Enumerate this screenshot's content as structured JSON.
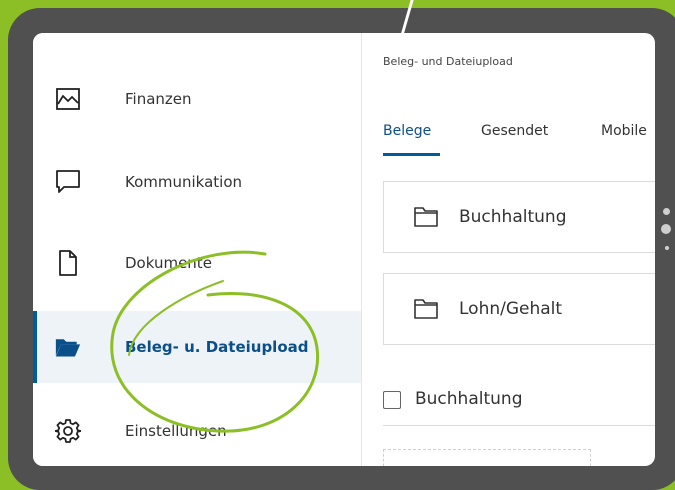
{
  "sidebar": {
    "items": [
      {
        "label": "Finanzen",
        "icon": "chart-line-icon"
      },
      {
        "label": "Kommunikation",
        "icon": "chat-bubble-icon"
      },
      {
        "label": "Dokumente",
        "icon": "document-icon"
      },
      {
        "label": "Beleg- u. Dateiupload",
        "icon": "folder-open-icon",
        "active": true
      },
      {
        "label": "Einstellungen",
        "icon": "gear-icon"
      }
    ]
  },
  "main": {
    "title": "Beleg- und Dateiupload",
    "tabs": [
      {
        "label": "Belege",
        "active": true
      },
      {
        "label": "Gesendet"
      },
      {
        "label": "Mobile"
      }
    ],
    "folders": [
      {
        "label": "Buchhaltung",
        "icon": "folder-icon"
      },
      {
        "label": "Lohn/Gehalt",
        "icon": "folder-icon"
      }
    ],
    "checkbox_label": "Buchhaltung"
  },
  "colors": {
    "background": "#8cbf26",
    "tablet": "#505050",
    "accent": "#005a9e",
    "annotation": "#8cbf26"
  }
}
